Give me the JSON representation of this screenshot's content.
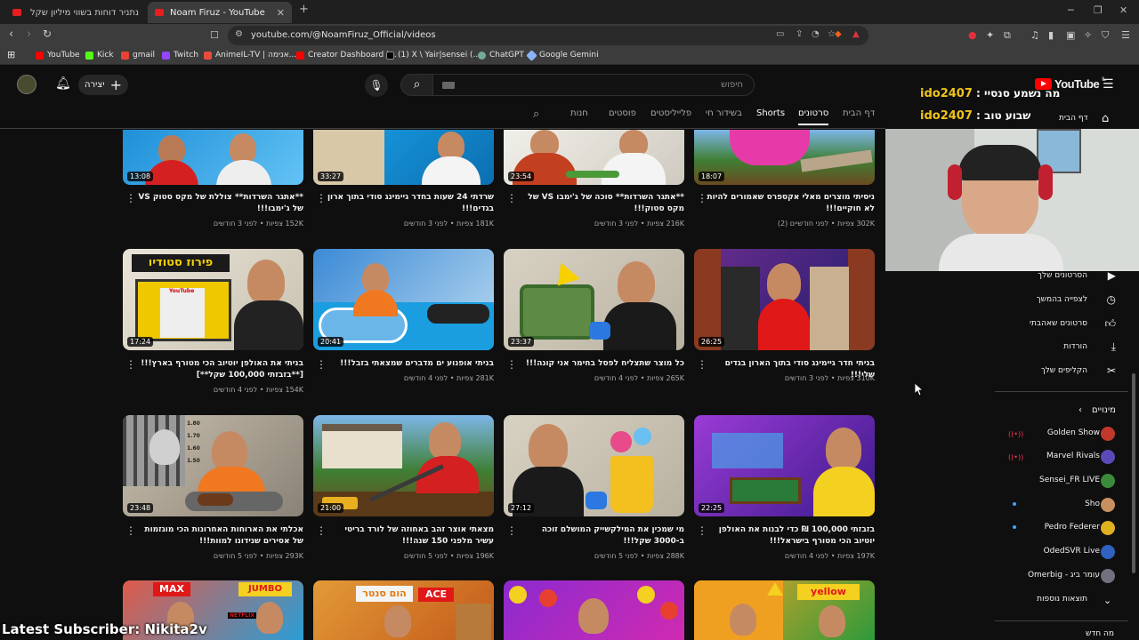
{
  "browser": {
    "tabs": [
      {
        "title": "נתניר דוחות בשווי מיליון שקל ביום אח",
        "active": false
      },
      {
        "title": "Noam Firuz - YouTube",
        "active": true
      }
    ],
    "url": "youtube.com/@NoamFiruz_Official/videos",
    "bookmarks": [
      {
        "label": "YouTube",
        "color": "#ff0000"
      },
      {
        "label": "Kick",
        "color": "#53fc18"
      },
      {
        "label": "gmail",
        "color": "#ea4335"
      },
      {
        "label": "Twitch",
        "color": "#9146ff"
      },
      {
        "label": "AnimeIL-TV | אנימה...",
        "color": "#e84b3c"
      },
      {
        "label": "Creator Dashboard |...",
        "color": "#ff0000"
      },
      {
        "label": "(1) X \\ Yair|sensei (...",
        "color": "#000000"
      },
      {
        "label": "ChatGPT",
        "color": "#74aa9c"
      },
      {
        "label": "Google Gemini",
        "color": "#8ab4f8"
      }
    ]
  },
  "header": {
    "create_label": "יצירה",
    "search_placeholder": "חיפוש",
    "logo_text": "YouTube",
    "logo_suffix": "IL"
  },
  "overlay": {
    "line1_name": "ido2407",
    "line1_label": " : מה נשמע סנסיי",
    "line2_name": "ido2407",
    "line2_label": " : שבוע טוב",
    "latest_subscriber": "Latest Subscriber: Nikita2v"
  },
  "channel_tabs": {
    "home": "דף הבית",
    "videos": "סרטונים",
    "shorts": "Shorts",
    "live": "בשידור חי",
    "playlists": "פלייליסטים",
    "posts": "פוסטים",
    "store": "חנות"
  },
  "videos": [
    {
      "title": "**אתגר השרדות** צוללת של מקס סטוק VS של ג'ימבו!!!",
      "views": "152K צפיות",
      "age": "לפני 3 חודשים",
      "duration": "13:08"
    },
    {
      "title": "שרדתי 24 שעות בחדר גיימינג סודי בתוך ארון בגדים!!!",
      "views": "181K צפיות",
      "age": "לפני 3 חודשים",
      "duration": "33:27"
    },
    {
      "title": "**אתגר השרדות** סוכה של ג'ימבו VS של מקס סטוק!!!",
      "views": "216K צפיות",
      "age": "לפני 3 חודשים",
      "duration": "23:54"
    },
    {
      "title": "ניסיתי מוצרים מאלי אקספרס שאמורים להיות לא חוקיים!!!",
      "views": "302K צפיות",
      "age": "לפני חודשיים (2)",
      "duration": "18:07"
    },
    {
      "title": "בניתי את האולפן יוטיוב הכי מטורף בארץ!!! [**בזבזתי 100,000 שקל**]",
      "views": "154K צפיות",
      "age": "לפני 4 חודשים",
      "duration": "17:24"
    },
    {
      "title": "בניתי אופנוע ים מדברים שמצאתי בזבל!!!",
      "views": "281K צפיות",
      "age": "לפני 4 חודשים",
      "duration": "20:41"
    },
    {
      "title": "כל מוצר שתצליח לפסל בחימר אני קונה!!!",
      "views": "265K צפיות",
      "age": "לפני 4 חודשים",
      "duration": "23:37"
    },
    {
      "title": "בניתי חדר גיימינג סודי בתוך הארון בגדים שלי!!!",
      "views": "310K צפיות",
      "age": "לפני 3 חודשים",
      "duration": "26:25"
    },
    {
      "title": "אכלתי את הארוחות האחרונות הכי מוגזמות של אסירים שנידונו למוות!!!",
      "views": "293K צפיות",
      "age": "לפני 5 חודשים",
      "duration": "23:48"
    },
    {
      "title": "מצאתי אוצר זהב באחוזה של לורד בריטי עשיר מלפני 150 שנה!!!",
      "views": "196K צפיות",
      "age": "לפני 5 חודשים",
      "duration": "21:00"
    },
    {
      "title": "מי שמכין את המילקשייק המושלם זוכה ב-3000 שקל!!!",
      "views": "288K צפיות",
      "age": "לפני 5 חודשים",
      "duration": "27:12"
    },
    {
      "title": "בזבזתי 100,000 ₪ כדי לבנות את האולפן יוטיוב הכי מטורף בישראל!!!",
      "views": "197K צפיות",
      "age": "לפני 4 חודשים",
      "duration": "22:25"
    }
  ],
  "thumb_text": {
    "studio": "פירוז סטודיו",
    "yt_sign": "YouTube",
    "max": "MAX",
    "jumbo": "JUMBO",
    "netflix": "NETFLIX",
    "home_center": "הום סנטר",
    "ace": "ACE",
    "yellow": "yellow",
    "ruler_1": "1.80",
    "ruler_2": "1.70",
    "ruler_3": "1.60",
    "ruler_4": "1.50"
  },
  "sidebar": {
    "home": "דף הבית",
    "items": [
      {
        "label": "הסרטונים שלך",
        "icon": "play-square-icon"
      },
      {
        "label": "לצפייה בהמשך",
        "icon": "clock-icon"
      },
      {
        "label": "סרטונים שאהבתי",
        "icon": "thumbs-up-icon"
      },
      {
        "label": "הורדות",
        "icon": "download-icon"
      },
      {
        "label": "הקליפים שלך",
        "icon": "scissors-icon"
      }
    ],
    "subs_heading": "מינויים",
    "subscriptions": [
      {
        "name": "Golden Show",
        "live": true,
        "color": "#c0392b"
      },
      {
        "name": "Marvel Rivals",
        "live": true,
        "color": "#5a4ab8"
      },
      {
        "name": "Sensei_FR LIVE",
        "live": false,
        "color": "#3a8a3a"
      },
      {
        "name": "Sho",
        "live": false,
        "dot": true,
        "color": "#c89060"
      },
      {
        "name": "Pedro Federer",
        "live": false,
        "dot": true,
        "color": "#e0b020"
      },
      {
        "name": "OdedSVR Live",
        "live": false,
        "color": "#3060c0"
      },
      {
        "name": "Omerbig - עומר ביג",
        "live": false,
        "color": "#707080"
      }
    ],
    "show_more": "תוצאות נוספות",
    "more": "מה חדש"
  }
}
